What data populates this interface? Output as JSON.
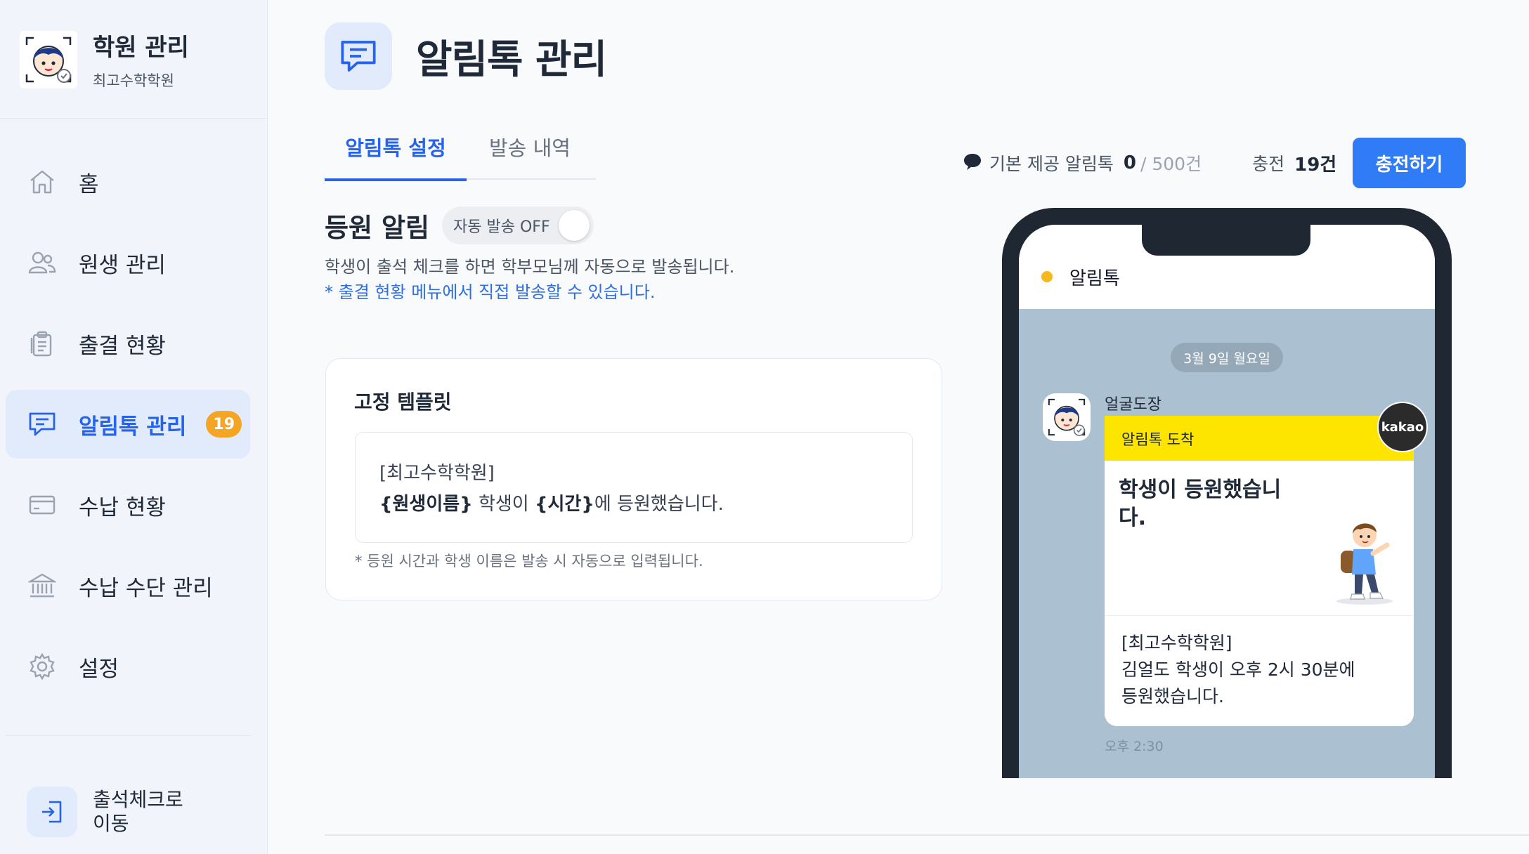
{
  "sidebar": {
    "brand_title": "학원 관리",
    "brand_subtitle": "최고수학학원",
    "items": [
      {
        "label": "홈",
        "icon": "home-icon"
      },
      {
        "label": "원생 관리",
        "icon": "users-icon"
      },
      {
        "label": "출결 현황",
        "icon": "clipboard-icon"
      },
      {
        "label": "알림톡 관리",
        "icon": "chat-icon",
        "badge": "19",
        "active": true
      },
      {
        "label": "수납 현황",
        "icon": "card-icon"
      },
      {
        "label": "수납 수단 관리",
        "icon": "bank-icon"
      },
      {
        "label": "설정",
        "icon": "gear-icon"
      }
    ],
    "checkin_label": "출석체크로 이동"
  },
  "header": {
    "title": "알림톡 관리"
  },
  "tabs": [
    {
      "label": "알림톡 설정",
      "active": true
    },
    {
      "label": "발송 내역",
      "active": false
    }
  ],
  "section": {
    "title": "등원 알림",
    "toggle_label": "자동 발송 OFF",
    "toggle_on": false,
    "description": "학생이 출석 체크를 하면 학부모님께 자동으로 발송됩니다.",
    "note": "* 출결 현황 메뉴에서 직접 발송할 수 있습니다."
  },
  "template_card": {
    "title": "고정 템플릿",
    "line1": "[최고수학학원]",
    "var_name": "{원생이름}",
    "text_mid": " 학생이 ",
    "var_time": "{시간}",
    "text_end": "에 등원했습니다.",
    "footnote": "* 등원 시간과 학생 이름은 발송 시 자동으로 입력됩니다."
  },
  "stats": {
    "base_label": "기본 제공 알림톡",
    "base_used": "0",
    "base_total": "/ 500건",
    "charge_label": "충전",
    "charge_value": "19건",
    "charge_button": "충전하기"
  },
  "preview": {
    "app_title": "알림톡",
    "date_chip": "3월 9일 월요일",
    "sender": "얼굴도장",
    "bar_label": "알림톡 도착",
    "hero_text": "학생이 등원했습니다.",
    "kakao_badge": "kakao",
    "body_line1": "[최고수학학원]",
    "body_line2": "김얼도 학생이 오후 2시 30분에",
    "body_line3": "등원했습니다.",
    "time": "오후 2:30"
  },
  "colors": {
    "accent": "#2563eb",
    "badge": "#f5a524",
    "kakao_yellow": "#fde500",
    "chat_bg": "#abc1d1"
  }
}
